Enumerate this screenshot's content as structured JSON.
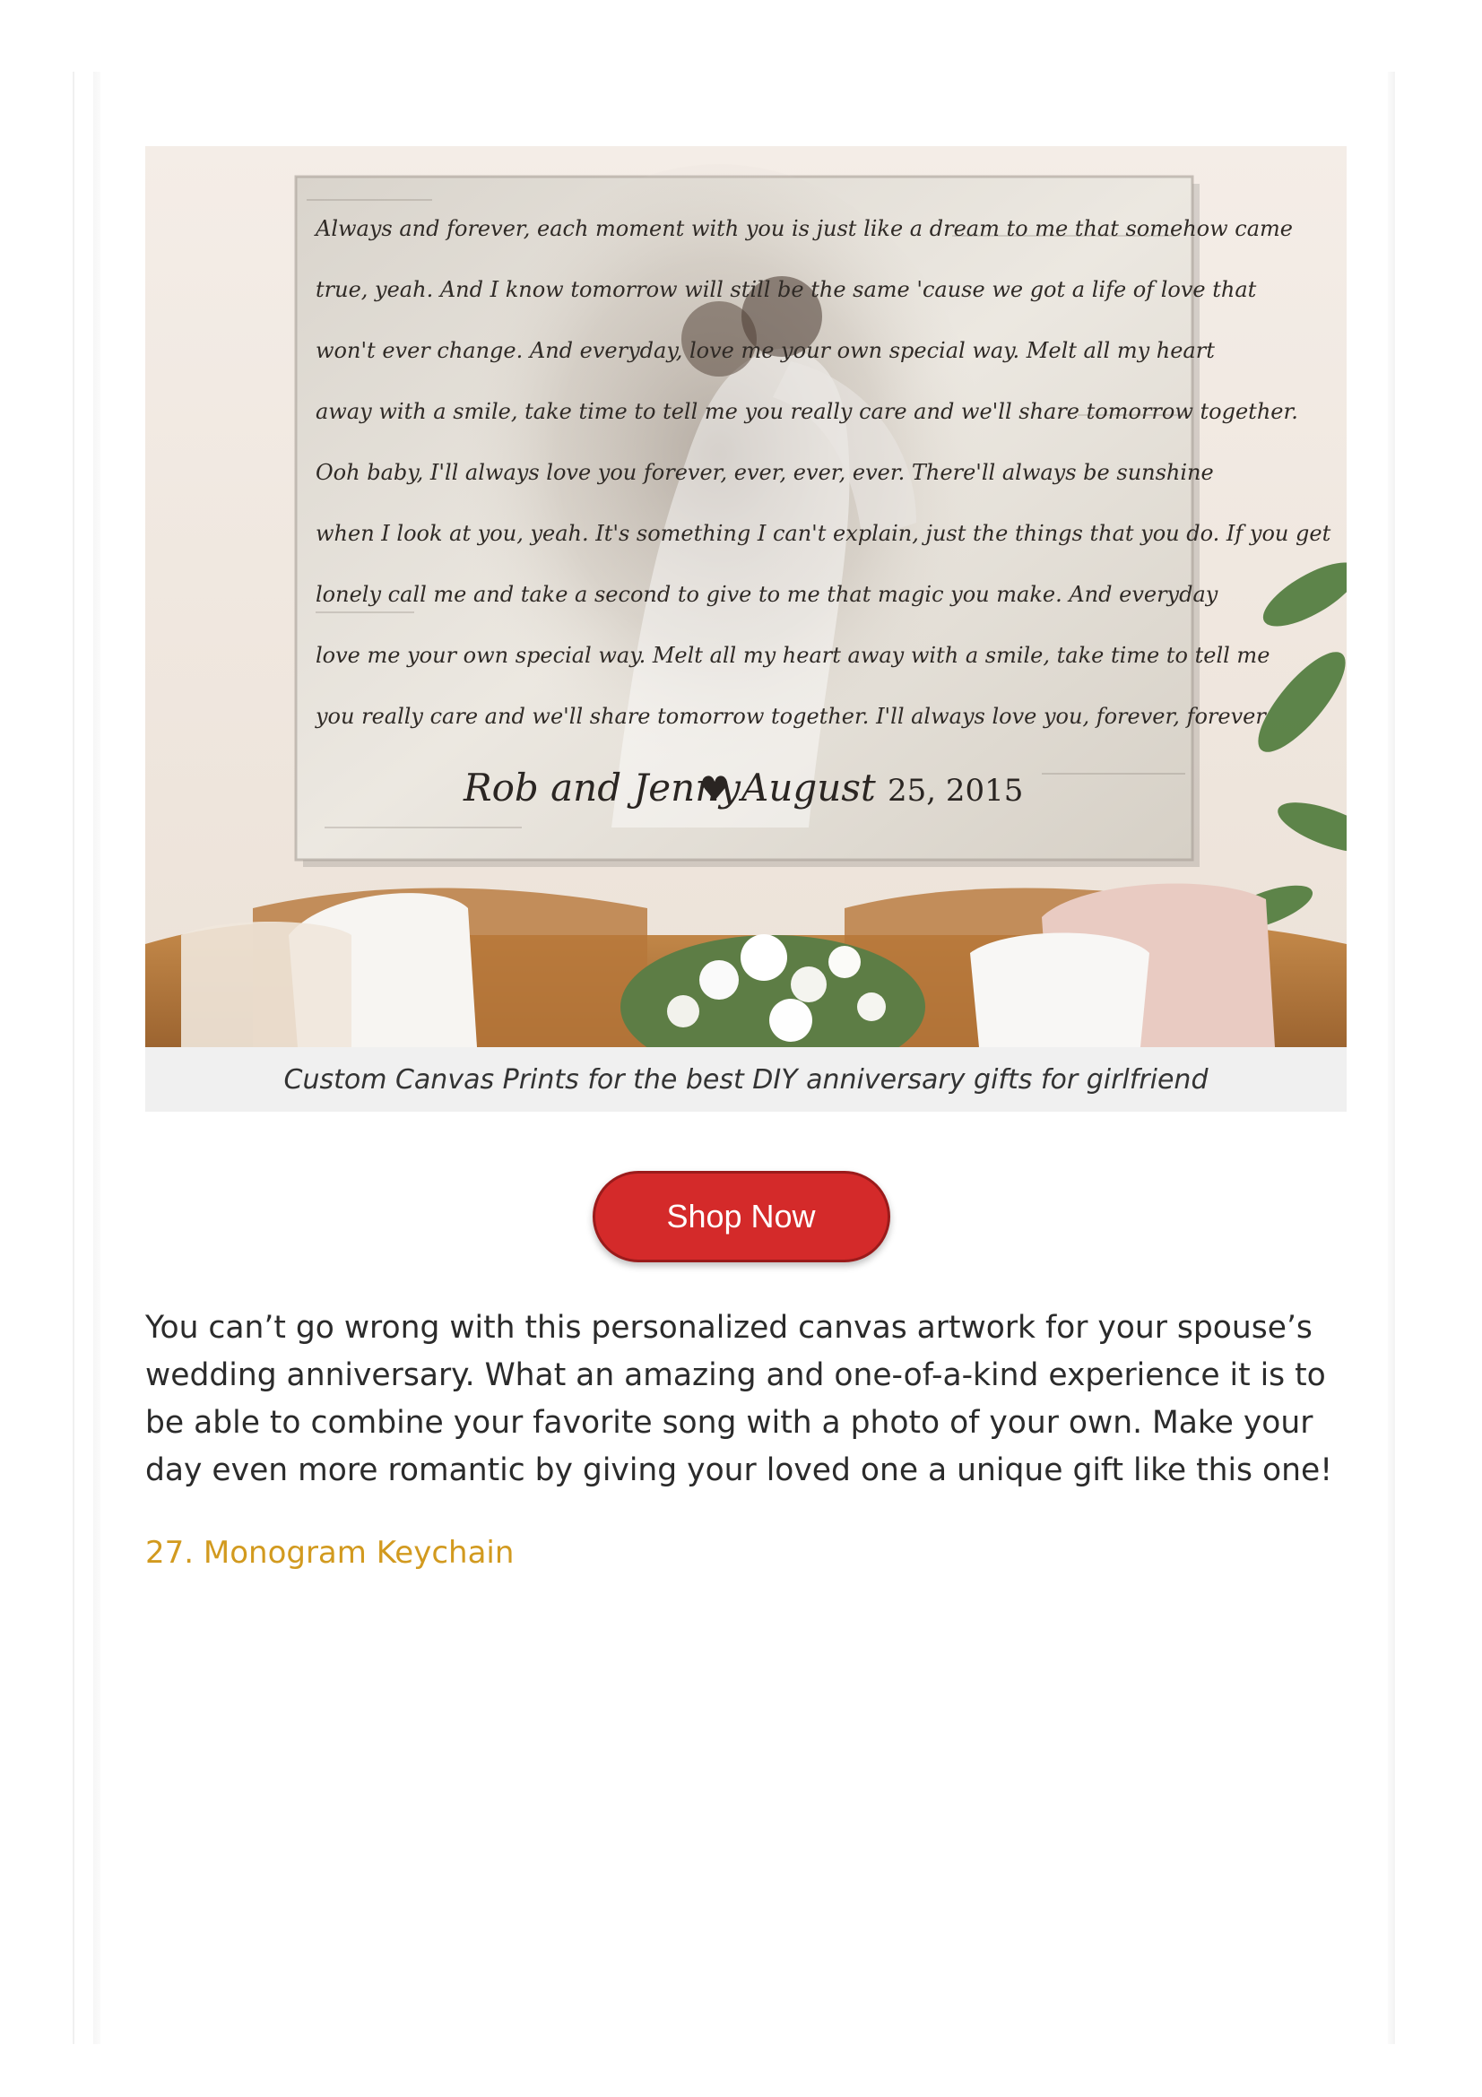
{
  "figure": {
    "caption": "Custom Canvas Prints for the best DIY anniversary gifts for girlfriend",
    "canvas_lyrics": [
      "Always and forever, each moment with you is just like a dream to me that somehow came",
      "true, yeah. And I know tomorrow will still be the same 'cause we got a life of love that",
      "won't ever change. And everyday, love me your own special way. Melt all my heart",
      "away with a smile, take time to tell me you really care and we'll share tomorrow together.",
      "Ooh baby, I'll always love you forever, ever, ever, ever. There'll always be sunshine",
      "when I look at you, yeah. It's something I can't explain, just the things that you do. If you get",
      "lonely call me and take a second to give to me that magic you make. And everyday",
      "love me your own special way. Melt all my heart away with a smile, take time to tell me",
      "you really care and we'll share tomorrow together. I'll always love you, forever, forever"
    ],
    "canvas_names": "Rob and Jenny",
    "canvas_heart": "♥",
    "canvas_month": "August",
    "canvas_date": "25, 2015"
  },
  "cta": {
    "label": "Shop Now",
    "color": "#d42a2a"
  },
  "body": {
    "paragraph": "You can’t go wrong with this personalized canvas artwork for your spouse’s wedding anniversary. What an amazing and one-of-a-kind experience it is to be able to combine your favorite song with a photo of your own. Make your day even more romantic by giving your loved one a unique gift like this one!"
  },
  "next_section": {
    "heading": "27. Monogram Keychain",
    "color": "#d29a1f"
  }
}
